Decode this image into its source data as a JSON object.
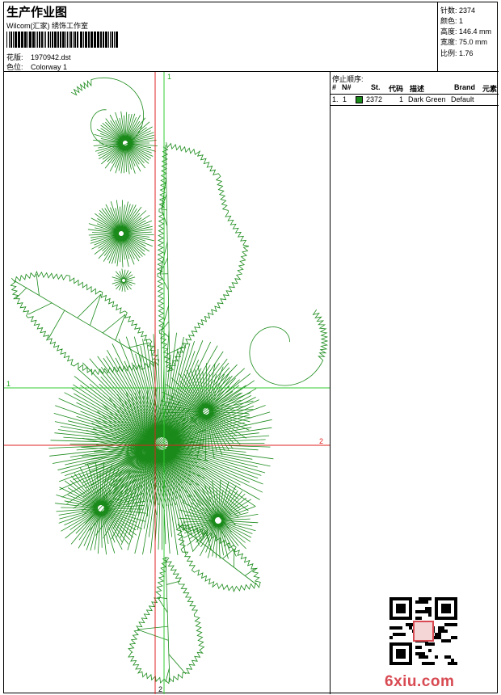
{
  "header": {
    "title": "生产作业图",
    "studio": "Wilcom(汇家) 绣饰工作室",
    "design_label": "花版:",
    "design_file": "1970942.dst",
    "colorway_label": "色位:",
    "colorway": "Colorway 1"
  },
  "stats": [
    {
      "label": "针数:",
      "value": "2374"
    },
    {
      "label": "颜色:",
      "value": "1"
    },
    {
      "label": "高度:",
      "value": "146.4 mm"
    },
    {
      "label": "宽度:",
      "value": "75.0 mm"
    },
    {
      "label": "比例:",
      "value": "1.76"
    }
  ],
  "guides": {
    "h1": "1",
    "h2": "2",
    "v1": "1",
    "v2": "2"
  },
  "stop_sequence": {
    "title": "停止顺序:",
    "columns": {
      "idx": "#",
      "n": "N#",
      "st": "St.",
      "code": "代码",
      "desc": "描述",
      "brand": "Brand",
      "elem": "元素"
    },
    "rows": [
      {
        "idx": "1.",
        "n": "1",
        "st": "2372",
        "code": "1",
        "desc": "Dark Green",
        "brand": "Default",
        "elem": ""
      }
    ]
  },
  "watermark": "6xiu.com",
  "colors": {
    "thread": "#1a8a1a",
    "guide_green": "#33cc33",
    "guide_red": "#e02020",
    "watermark": "#d84a52"
  }
}
